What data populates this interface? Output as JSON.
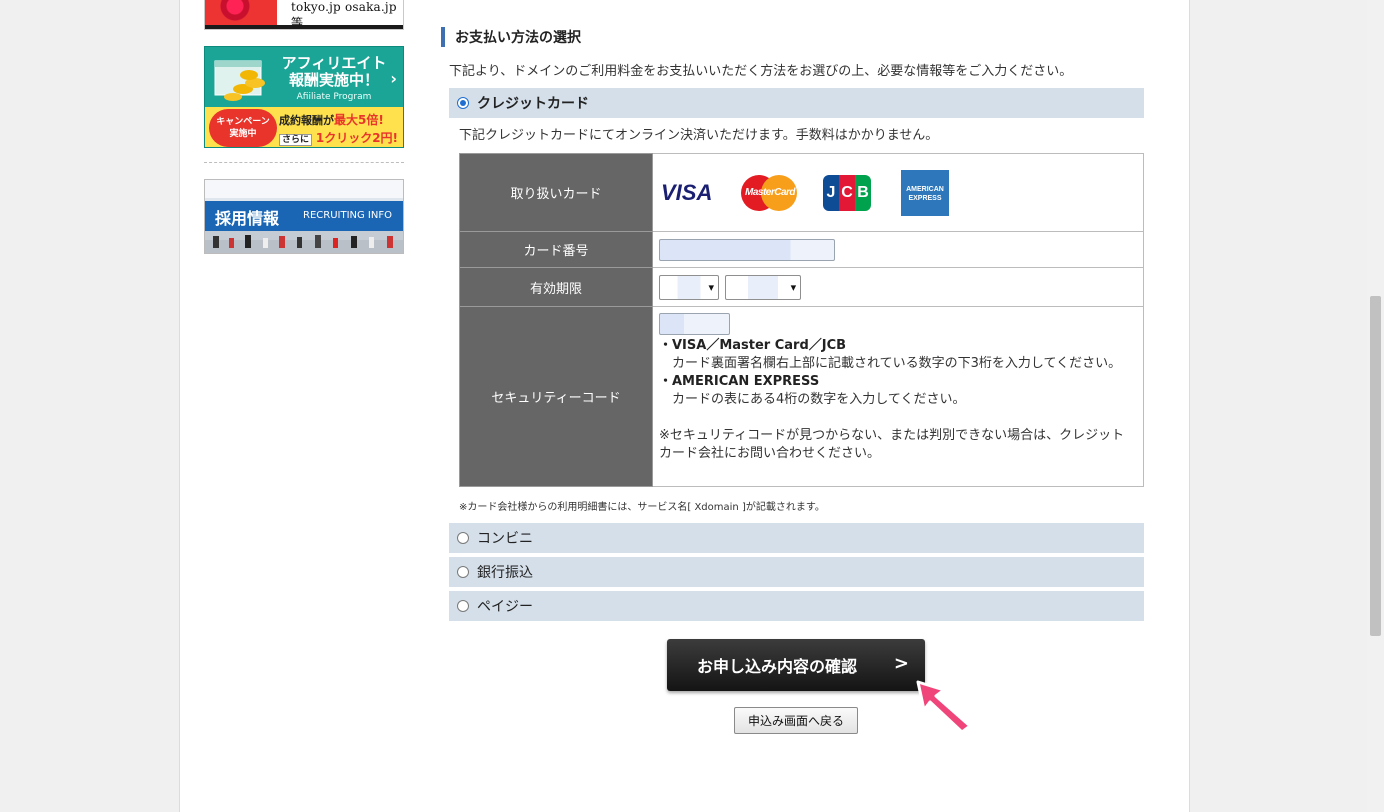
{
  "sidebar": {
    "domains_banner_text": "tokyo.jp osaka.jp 等",
    "affiliate": {
      "title_line1": "アフィリエイト",
      "title_line2": "報酬実施中！",
      "subtitle": "Afiiliate Program",
      "campaign_line1": "キャンペーン",
      "campaign_line2": "実施中",
      "reward_prefix": "成約報酬が",
      "reward_highlight": "最大5倍!",
      "click_tag": "さらに",
      "click_highlight": "1クリック2円!"
    },
    "recruit": {
      "title": "採用情報",
      "subtitle": "RECRUITING INFO"
    }
  },
  "main": {
    "section_title": "お支払い方法の選択",
    "lead_text": "下記より、ドメインのご利用料金をお支払いいただく方法をお選びの上、必要な情報等をご入力ください。",
    "credit_card": {
      "label": "クレジットカード",
      "selected": true,
      "note": "下記クレジットカードにてオンライン決済いただけます。手数料はかかりません。",
      "rows": {
        "cards_label": "取り扱いカード",
        "number_label": "カード番号",
        "expiry_label": "有効期限",
        "security_label": "セキュリティーコード"
      },
      "logos": {
        "visa": "VISA",
        "mastercard": "MasterCard",
        "jcb": [
          "J",
          "C",
          "B"
        ],
        "amex_line1": "AMERICAN",
        "amex_line2": "EXPRESS"
      },
      "security_help": {
        "brand1": "・VISA／Master Card／JCB",
        "brand1_desc": "　カード裏面署名欄右上部に記載されている数字の下3桁を入力してください。",
        "brand2": "・AMERICAN EXPRESS",
        "brand2_desc": "　カードの表にある4桁の数字を入力してください。",
        "notice": "※セキュリティコードが見つからない、または判別できない場合は、クレジットカード会社にお問い合わせください。"
      },
      "footnote": "※カード会社様からの利用明細書には、サービス名[ Xdomain ]が記載されます。"
    },
    "other_methods": [
      "コンビニ",
      "銀行振込",
      "ペイジー"
    ],
    "confirm_button": "お申し込み内容の確認",
    "confirm_chevron": ">",
    "back_button": "申込み画面へ戻る"
  },
  "colors": {
    "accent_bar": "#d4dfea",
    "heading_mark": "#3e6fb0",
    "table_header": "#666666",
    "pointer": "#f0457a"
  },
  "icons": [
    "radio-checked-icon",
    "radio-unchecked-icon",
    "chevron-right-icon",
    "pointer-arrow-icon"
  ]
}
